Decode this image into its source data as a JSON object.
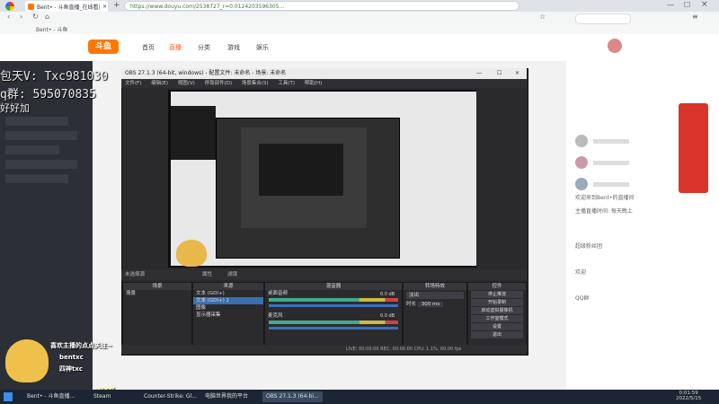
{
  "browser": {
    "tab_title": "Bent• - 斗鱼直播_在线看直播",
    "url": "https://www.douyu.com/2538727_r=0.0124203596305...",
    "bookmark": "Bent• - 斗鱼"
  },
  "site": {
    "logo": "斗鱼",
    "nav": [
      "首页",
      "直播",
      "分类",
      "游戏",
      "娱乐"
    ]
  },
  "overlay": {
    "line1": "包天V: Txc981030",
    "line2": "q群: 595070835",
    "line3": "好好加"
  },
  "obs": {
    "title": "OBS 27.1.3 (64-bit, windows) - 配置文件: 未命名 - 场景: 未命名",
    "menu": [
      "文件(F)",
      "编辑(E)",
      "视图(V)",
      "停靠部件(D)",
      "场景集合(S)",
      "工具(T)",
      "帮助(H)"
    ],
    "status_left": "未选择源",
    "status_buttons": [
      "属性",
      "滤镜"
    ],
    "docks": {
      "scenes": {
        "title": "场景",
        "items": [
          "场景"
        ]
      },
      "sources": {
        "title": "来源",
        "items": [
          "文本 (GDI+)",
          "文本 (GDI+) 2",
          "图像",
          "显示器采集"
        ]
      },
      "mixer": {
        "title": "混音器",
        "channels": [
          {
            "name": "桌面音频",
            "db": "0.0 dB"
          },
          {
            "name": "麦克风",
            "db": "0.0 dB"
          }
        ]
      },
      "transitions": {
        "title": "转场特效",
        "type": "淡出",
        "duration_label": "时长",
        "duration": "300 ms"
      },
      "controls": {
        "title": "控件",
        "buttons": [
          "停止推流",
          "开始录制",
          "启动虚拟摄像机",
          "工作室模式",
          "设置",
          "退出"
        ]
      }
    },
    "bottom": "LIVE: 00:00:00   REC: 00:00:00   CPU: 1.1%, 60.00 fps"
  },
  "alerts": {
    "welcome": "喜欢主播的点点关注~",
    "names": [
      "bentxc",
      "四神txc"
    ],
    "vx": "+VX群"
  },
  "chat": {
    "lines": [
      "欢迎来到Bent•的直播间",
      "主播直播时间: 每天晚上",
      "超级粉丝团",
      "欢迎",
      "QQ群"
    ]
  },
  "taskbar": {
    "items": [
      "Bent• - 斗鱼直播...",
      "Steam",
      "Counter-Strike: Gl...",
      "电脑世界我的平台",
      "OBS 27.1.3 (64-bi..."
    ],
    "time": "0:01:59",
    "date": "2022/5/15"
  }
}
